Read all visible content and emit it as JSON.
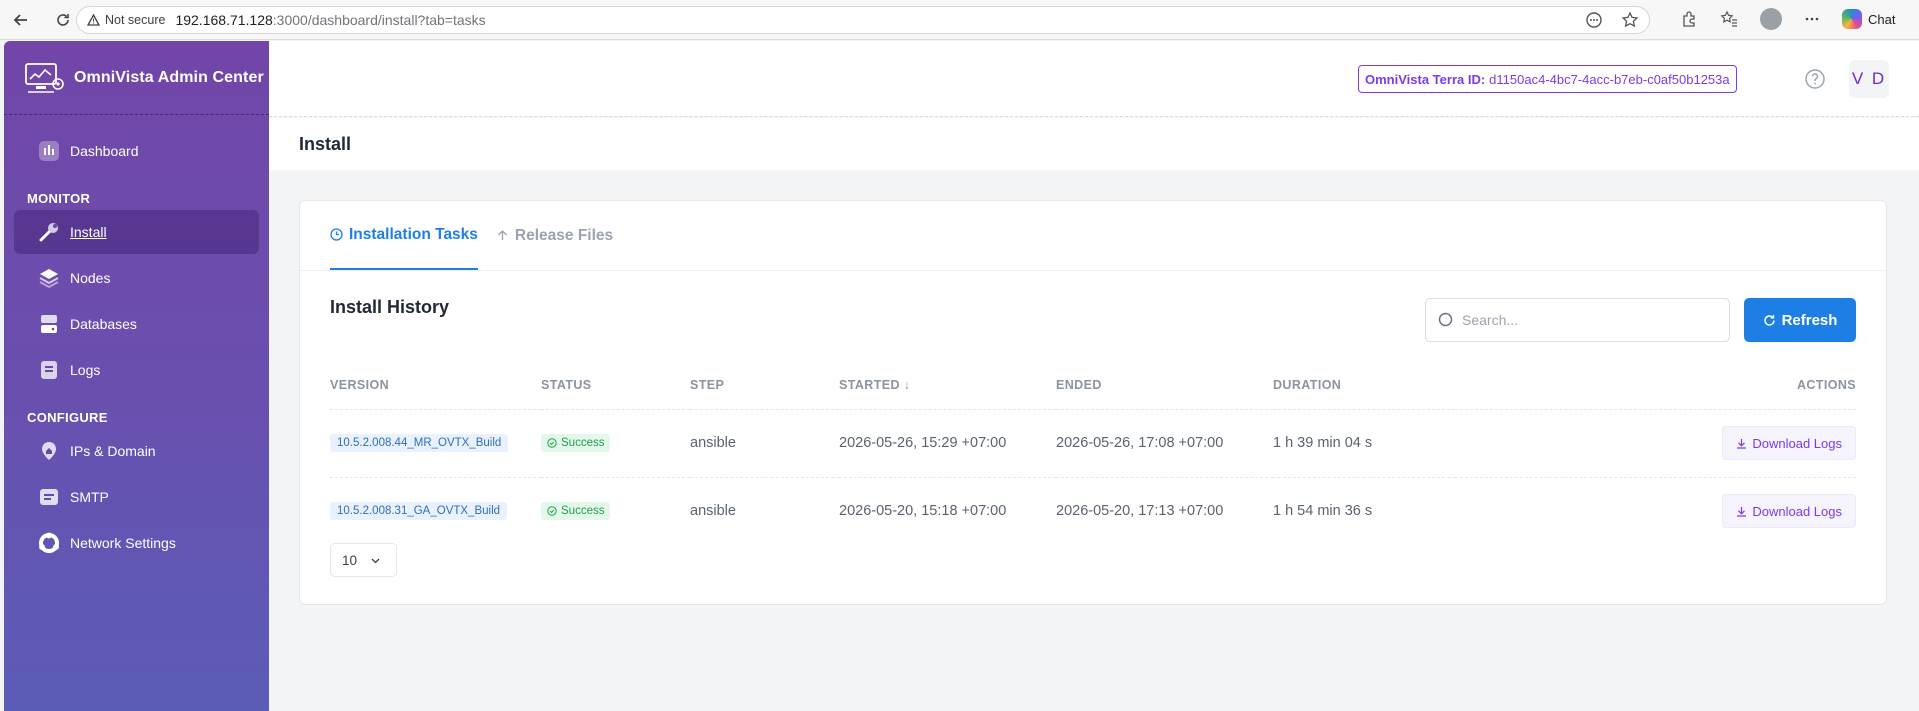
{
  "browser": {
    "not_secure": "Not secure",
    "url_host": "192.168.71.128",
    "url_path": ":3000/dashboard/install?tab=tasks",
    "chat_label": "Chat"
  },
  "brand": {
    "name": "OmniVista Admin Center"
  },
  "sidebar": {
    "dashboard": "Dashboard",
    "monitor_title": "MONITOR",
    "monitor_items": [
      {
        "label": "Install",
        "icon": "wrench-icon",
        "active": true
      },
      {
        "label": "Nodes",
        "icon": "layers-icon"
      },
      {
        "label": "Databases",
        "icon": "database-icon"
      },
      {
        "label": "Logs",
        "icon": "document-icon"
      }
    ],
    "configure_title": "CONFIGURE",
    "configure_items": [
      {
        "label": "IPs & Domain",
        "icon": "home-pin-icon"
      },
      {
        "label": "SMTP",
        "icon": "mail-icon"
      },
      {
        "label": "Network Settings",
        "icon": "network-icon"
      }
    ]
  },
  "header": {
    "terra_label": "OmniVista Terra ID:",
    "terra_id": "d1150ac4-4bc7-4acc-b7eb-c0af50b1253a",
    "user_initials": "V D"
  },
  "page": {
    "title": "Install"
  },
  "tabs": [
    {
      "label": "Installation Tasks",
      "active": true
    },
    {
      "label": "Release Files",
      "active": false
    }
  ],
  "history": {
    "title": "Install History",
    "search_placeholder": "Search...",
    "refresh_label": "Refresh",
    "columns": [
      "VERSION",
      "STATUS",
      "STEP",
      "STARTED ↓",
      "ENDED",
      "DURATION",
      "ACTIONS"
    ],
    "rows": [
      {
        "version": "10.5.2.008.44_MR_OVTX_Build",
        "status": "Success",
        "step": "ansible",
        "started": "2026-05-26, 15:29 +07:00",
        "ended": "2026-05-26, 17:08 +07:00",
        "duration": "1 h 39 min 04 s",
        "action": "Download Logs"
      },
      {
        "version": "10.5.2.008.31_GA_OVTX_Build",
        "status": "Success",
        "step": "ansible",
        "started": "2026-05-20, 15:18 +07:00",
        "ended": "2026-05-20, 17:13 +07:00",
        "duration": "1 h 54 min 36 s",
        "action": "Download Logs"
      }
    ],
    "page_size": "10"
  },
  "colors": {
    "accent": "#1d7fe6",
    "purple": "#7c3aed",
    "success": "#21a04b"
  }
}
